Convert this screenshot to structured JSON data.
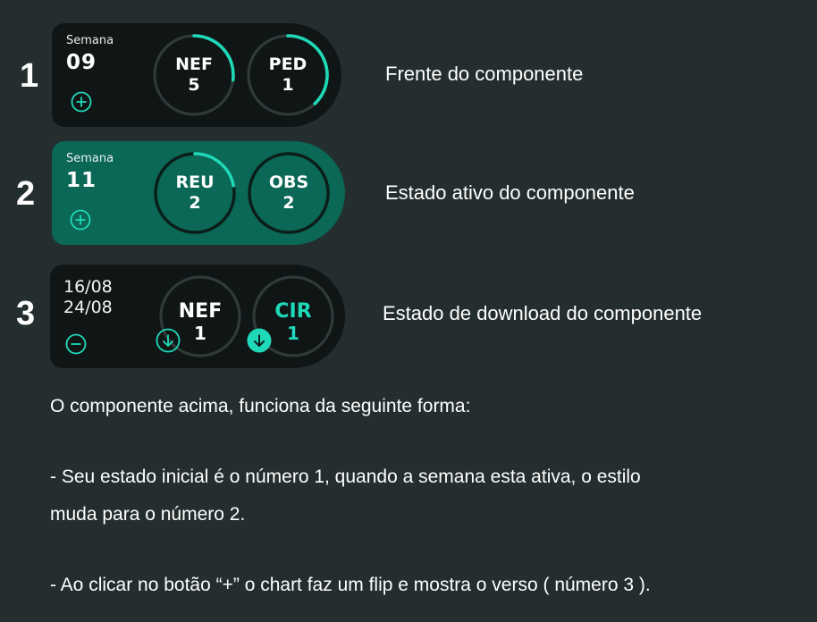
{
  "rows": [
    {
      "number": "1",
      "label": "Semana",
      "week": "09",
      "caption": "Frente do componente",
      "rings": [
        {
          "code": "NEF",
          "count": "5",
          "progress": 0.27
        },
        {
          "code": "PED",
          "count": "1",
          "progress": 0.38
        }
      ]
    },
    {
      "number": "2",
      "label": "Semana",
      "week": "11",
      "caption": "Estado ativo do componente",
      "rings": [
        {
          "code": "REU",
          "count": "2",
          "progress": 0.22
        },
        {
          "code": "OBS",
          "count": "2",
          "progress": 0
        }
      ]
    },
    {
      "number": "3",
      "date_start": "16/08",
      "date_end": "24/08",
      "caption": "Estado de download do componente",
      "rings": [
        {
          "code": "NEF",
          "count": "1"
        },
        {
          "code": "CIR",
          "count": "1"
        }
      ]
    }
  ],
  "description": {
    "intro": "O componente acima, funciona da seguinte forma:",
    "line1": "- Seu estado inicial é o número 1, quando a semana esta ativa, o estilo",
    "line2": "muda para o número 2.",
    "line3": "- Ao clicar no botão “+”  o chart faz um flip e mostra o verso ( número 3 )."
  },
  "colors": {
    "background": "#242e2e",
    "card_dark": "#101616",
    "card_active": "#0b6756",
    "accent": "#1fd9b9",
    "ring_track": "#2f3a39",
    "ring_track_active": "#0b1d19"
  },
  "icons": [
    "plus-circle-icon",
    "minus-circle-icon",
    "download-arrow-icon",
    "download-filled-icon"
  ]
}
